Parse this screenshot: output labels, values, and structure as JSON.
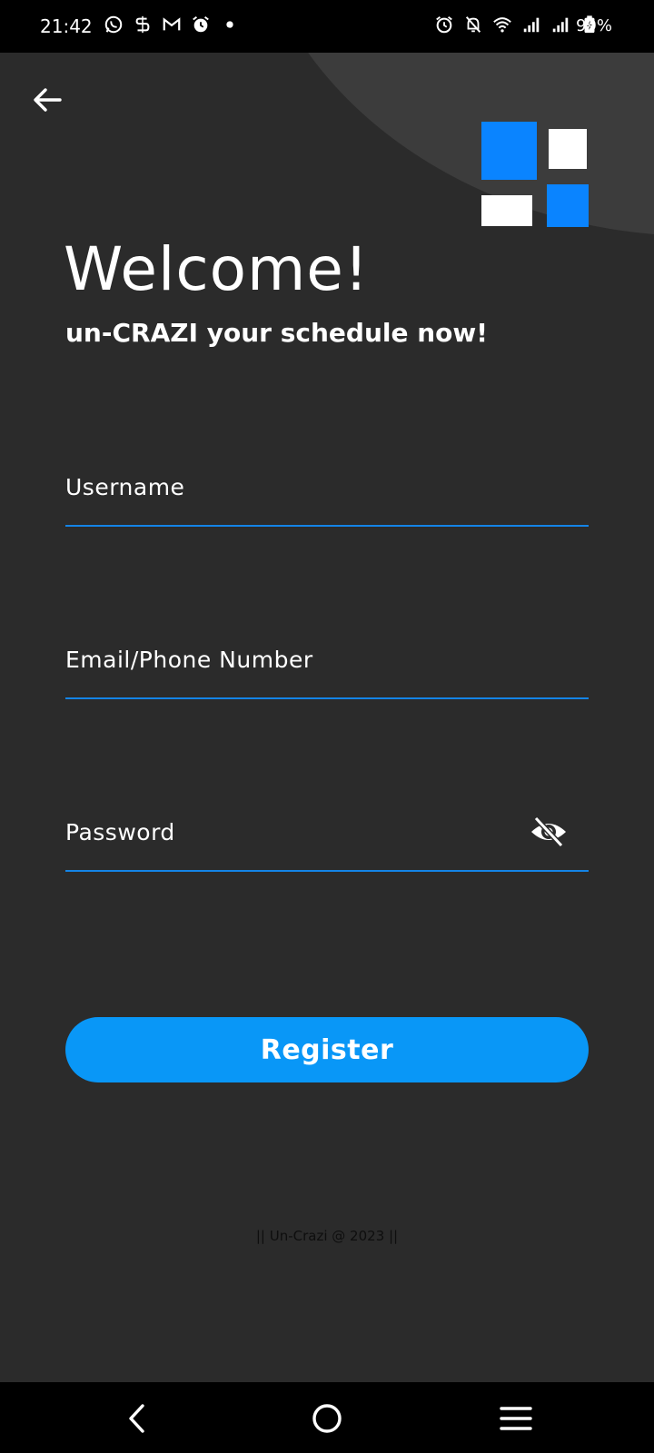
{
  "status_bar": {
    "time": "21:42",
    "battery": "99%",
    "left_icons": [
      "whatsapp-icon",
      "s-app-icon",
      "gmail-icon",
      "alarm-icon",
      "dot-icon"
    ],
    "right_icons": [
      "alarm-icon",
      "bell-off-icon",
      "wifi-icon",
      "signal-icon",
      "signal-icon",
      "battery-charging-icon"
    ]
  },
  "header": {
    "title": "Welcome!",
    "subtitle": "un-CRAZI your schedule now!"
  },
  "form": {
    "username_placeholder": "Username",
    "email_placeholder": "Email/Phone Number",
    "password_placeholder": "Password",
    "register_label": "Register"
  },
  "footer": {
    "text": "|| Un-Crazi @ 2023 ||"
  },
  "colors": {
    "background": "#2b2b2b",
    "accent": "#0997f7",
    "underline": "#1484e6",
    "logo_blue": "#0a84ff"
  }
}
